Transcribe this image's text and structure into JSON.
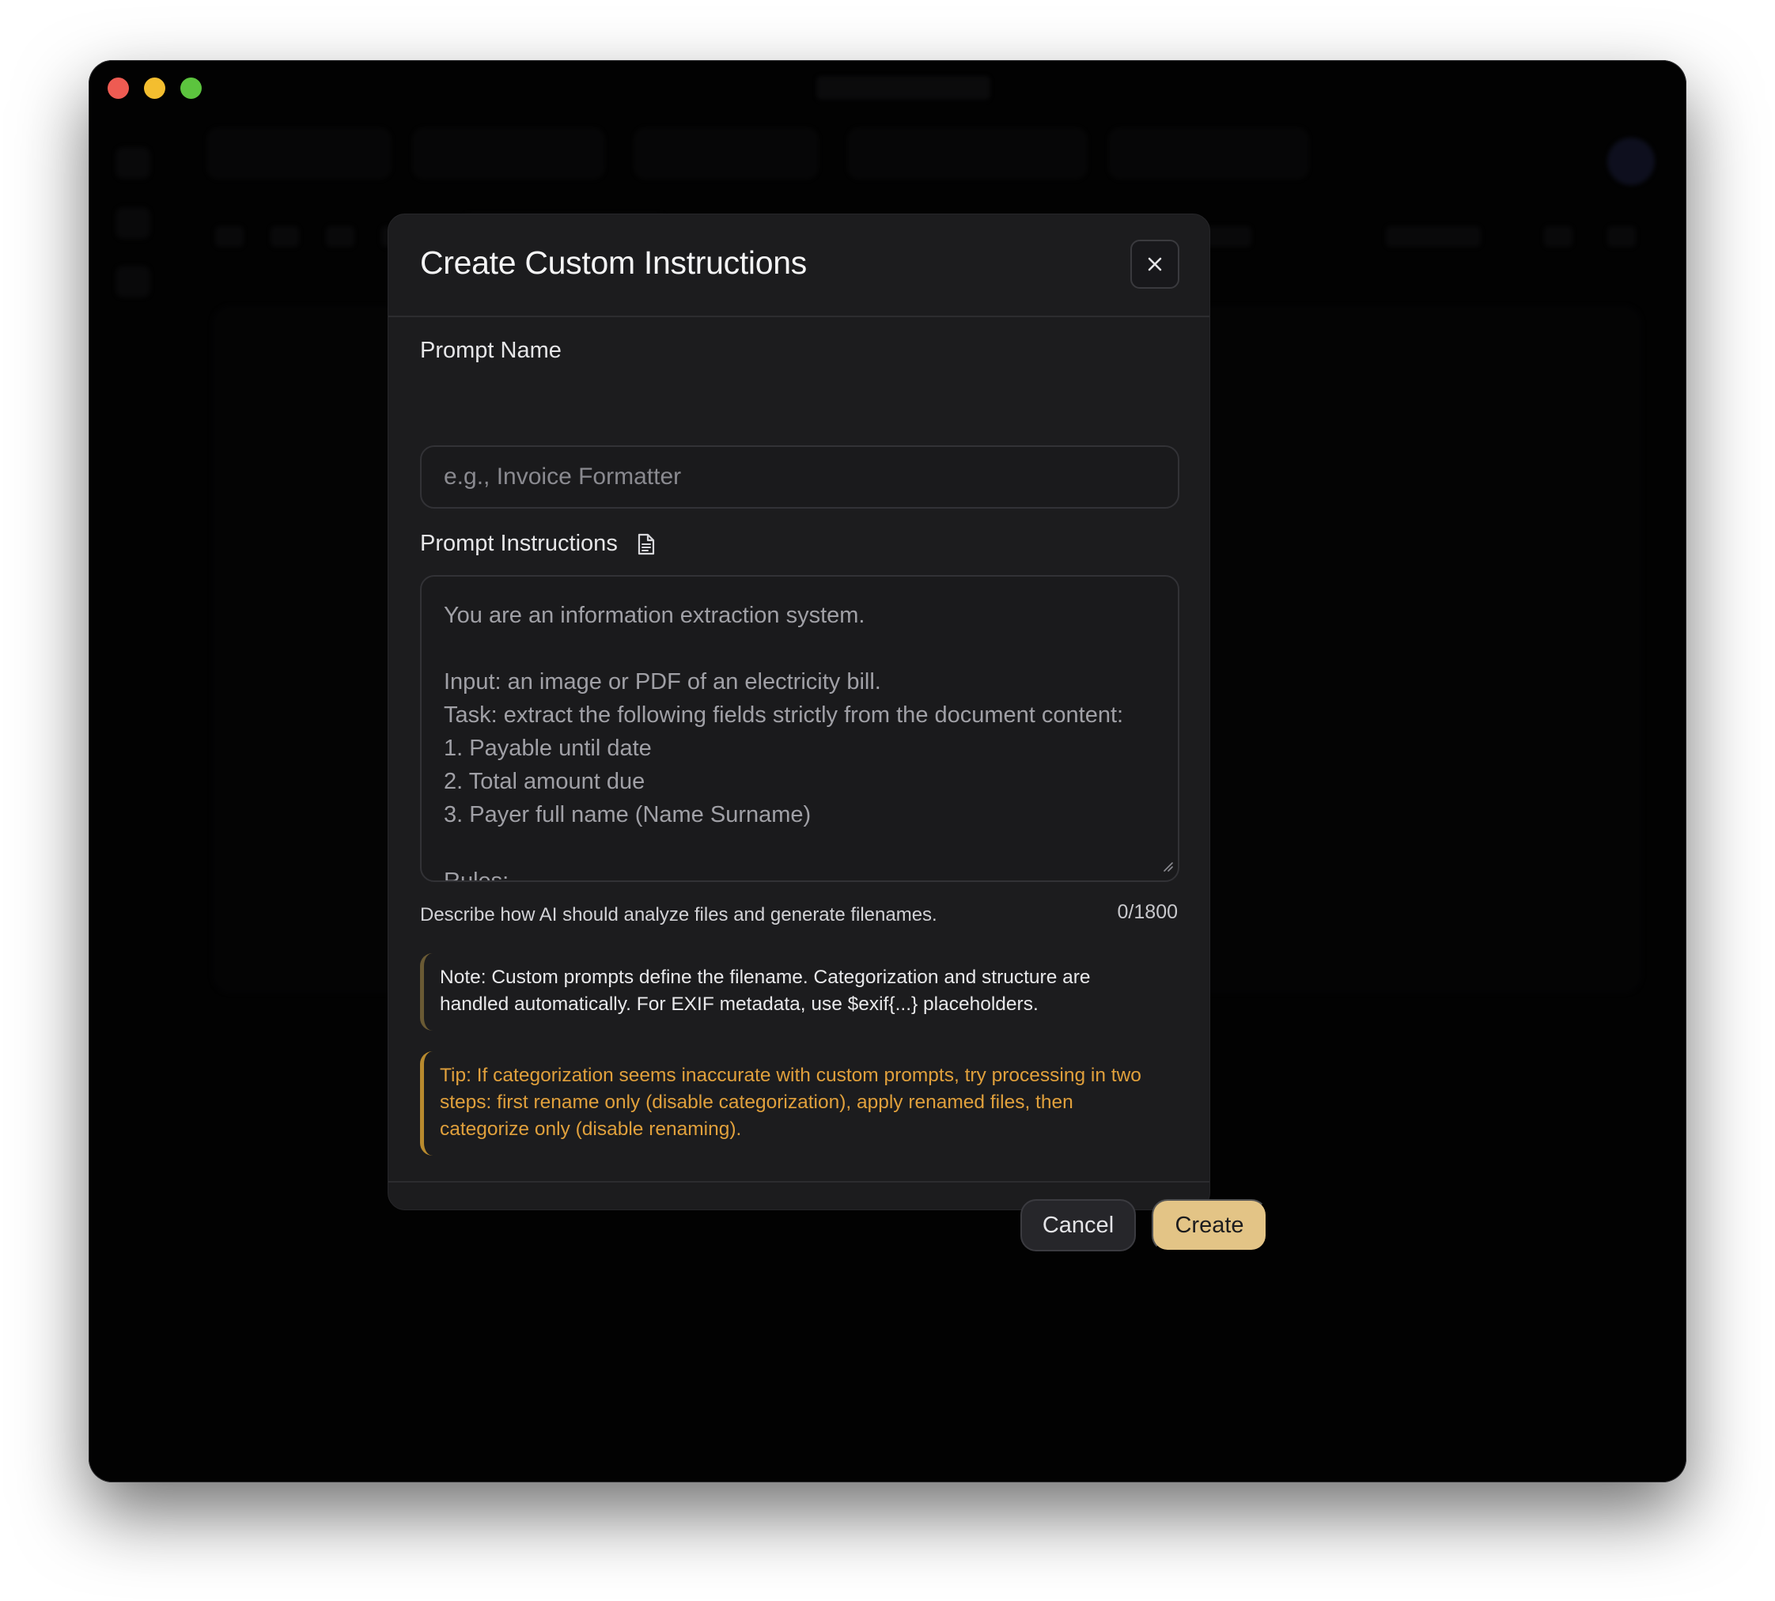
{
  "window": {
    "traffic_lights": {
      "close": "#ee5b52",
      "minimize": "#f4be2f",
      "maximize": "#5cc43e"
    }
  },
  "dialog": {
    "title": "Create Custom Instructions",
    "close_icon": "close-icon",
    "prompt_name": {
      "label": "Prompt Name",
      "value": "",
      "placeholder": "e.g., Invoice Formatter"
    },
    "prompt_instructions": {
      "label": "Prompt Instructions",
      "icon": "document-icon",
      "lines": [
        "You are an information extraction system.",
        "",
        "Input: an image or PDF of an electricity bill.",
        "Task: extract the following fields strictly from the document content:",
        "1. Payable until date",
        "2. Total amount due",
        "3. Payer full name (Name Surname)",
        "",
        "Rules:"
      ]
    },
    "helper_text": "Describe how AI should analyze files and generate filenames.",
    "char_count": "0/1800",
    "note": "Note: Custom prompts define the filename. Categorization and structure are handled automatically. For EXIF metadata, use $exif{...} placeholders.",
    "tip": "Tip: If categorization seems inaccurate with custom prompts, try processing in two steps: first rename only (disable categorization), apply renamed files, then categorize only (disable renaming).",
    "cancel_label": "Cancel",
    "create_label": "Create"
  },
  "colors": {
    "accent": "#e3c486",
    "tip_text": "#e0a03c",
    "dialog_bg": "#1c1c1e"
  }
}
